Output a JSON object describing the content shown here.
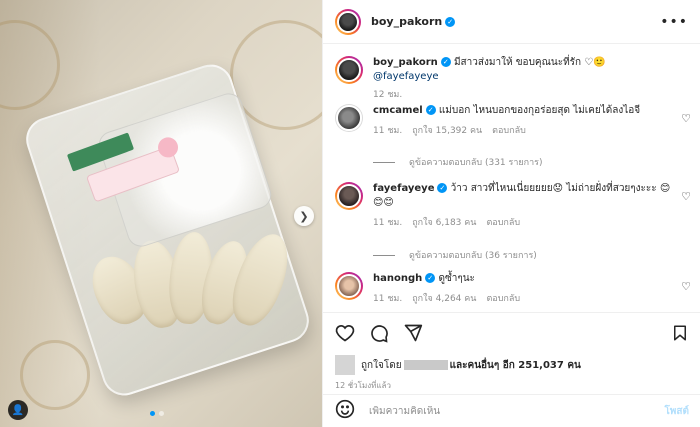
{
  "post": {
    "author": "boy_pakorn",
    "caption_author": "boy_pakorn",
    "caption_text": "มีสาวส่งมาให้ ขอบคุณนะที่รัก ♡🙂",
    "caption_mention": "@fayefayeye",
    "caption_time": "12 ชม.",
    "more_icon": "more-horizontal-icon"
  },
  "comments": [
    {
      "user": "cmcamel",
      "text": "แม่บอก ไหนบอกของกุอร่อยสุด ไม่เคยได้ลงไอจี",
      "time": "11 ชม.",
      "likes": "ถูกใจ 15,392 คน",
      "reply": "ตอบกลับ",
      "view_replies": "ดูข้อความตอบกลับ (331 รายการ)"
    },
    {
      "user": "fayefayeye",
      "text": "ว้าว สาวที่ไหนเนี่ยยยยย😟 ไม่ถ่ายฝั่งที่สวยๆงะะะ 😊😊😊",
      "time": "11 ชม.",
      "likes": "ถูกใจ 6,183 คน",
      "reply": "ตอบกลับ",
      "view_replies": "ดูข้อความตอบกลับ (36 รายการ)"
    },
    {
      "user": "hanongh",
      "text": "ดูซ้ำๆนะ",
      "time": "11 ชม.",
      "likes": "ถูกใจ 4,264 คน",
      "reply": "ตอบกลับ"
    }
  ],
  "liked_by": {
    "prefix": "ถูกใจโดย",
    "suffix": "และคนอื่นๆ อีก 251,037 คน"
  },
  "posted_time": "12 ชั่วโมงที่แล้ว",
  "composer": {
    "placeholder": "เพิ่มความคิดเห็น",
    "post_label": "โพสต์"
  },
  "colors": {
    "link": "#00376b",
    "verified": "#0095f6",
    "post_disabled": "#b2dffc"
  }
}
